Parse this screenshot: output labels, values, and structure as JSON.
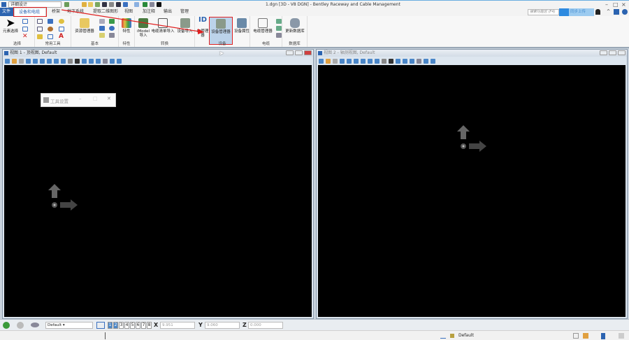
{
  "title_bar": {
    "workspace": "详细设计",
    "title": "1.dgn [3D - V8 DGN] - Bentley Raceway and Cable Management"
  },
  "tabs": [
    "文件",
    "设备和电缆",
    "桥架",
    "地下系统",
    "提取二维图形",
    "视图",
    "加注释",
    "输出",
    "管理"
  ],
  "search_placeholder": "搜索功能区 (F4)",
  "cloud_label": "同步上传",
  "ribbon": {
    "select": {
      "button": "元素选择",
      "label": "选择"
    },
    "common": {
      "label": "常用工具",
      "text_icon": "A"
    },
    "basic": {
      "button": "资源管理器",
      "label": "基本"
    },
    "props": {
      "button": "特性",
      "label": "特性"
    },
    "convert": {
      "buttons": [
        "iModel导入",
        "电缆清单导入",
        "设备导入"
      ],
      "label": "转换"
    },
    "equipment": {
      "buttons": [
        "ID管理器",
        "设备管理器",
        "设备属性"
      ],
      "id_text": "ID",
      "label": "设备"
    },
    "cable": {
      "button": "电缆管理器",
      "label": "电缆"
    },
    "database": {
      "button": "更新数据库",
      "label": "数据库"
    }
  },
  "views": [
    {
      "title": "视图 1 - 顶视图, Default"
    },
    {
      "title": "视图 2 - 轴测视图, Default"
    }
  ],
  "tool_settings": {
    "title": "工具设置"
  },
  "bottom_toolbar": {
    "level": "Default",
    "view_numbers": [
      "1",
      "2",
      "3",
      "4",
      "5",
      "6",
      "7",
      "8"
    ],
    "x_label": "X",
    "x": "9.951",
    "y_label": "Y",
    "y": "9.060",
    "z_label": "Z",
    "z": "0.000"
  },
  "status_bar": {
    "level": "Default"
  },
  "colors": {
    "accent": "#2b63b0",
    "highlight": "#e02020"
  }
}
